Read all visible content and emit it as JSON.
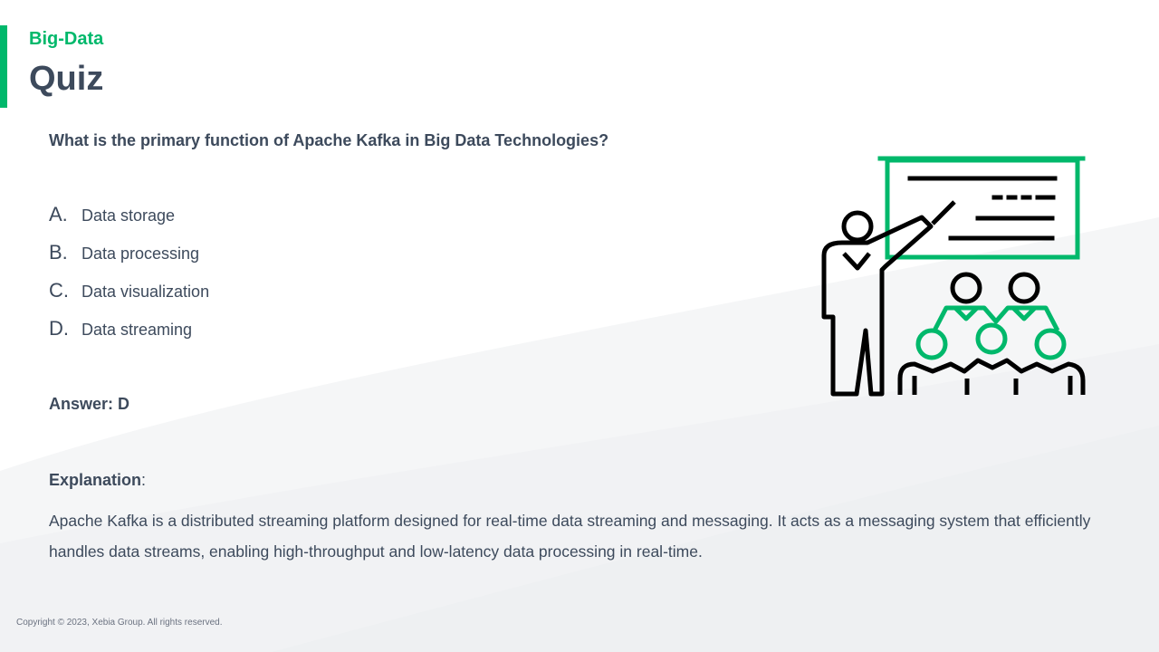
{
  "header": {
    "eyebrow": "Big-Data",
    "title": "Quiz"
  },
  "quiz": {
    "question": "What is the primary function of Apache Kafka in Big Data Technologies?",
    "options": [
      {
        "letter": "A.",
        "text": "Data storage"
      },
      {
        "letter": "B.",
        "text": "Data processing"
      },
      {
        "letter": "C.",
        "text": "Data visualization"
      },
      {
        "letter": "D.",
        "text": "Data streaming"
      }
    ],
    "answer": "Answer: D",
    "explanation_label": "Explanation",
    "explanation_colon": ":",
    "explanation": "Apache Kafka is a distributed streaming platform designed for real-time data streaming and messaging. It acts as a messaging system that efficiently handles data streams, enabling high-throughput and low-latency data processing in real-time."
  },
  "footer": {
    "copyright": "Copyright © 2023, Xebia Group. All rights reserved."
  },
  "colors": {
    "accent": "#00b86b",
    "text": "#3d4a5c"
  },
  "illustration": {
    "icon": "presentation-teacher-audience-icon"
  }
}
